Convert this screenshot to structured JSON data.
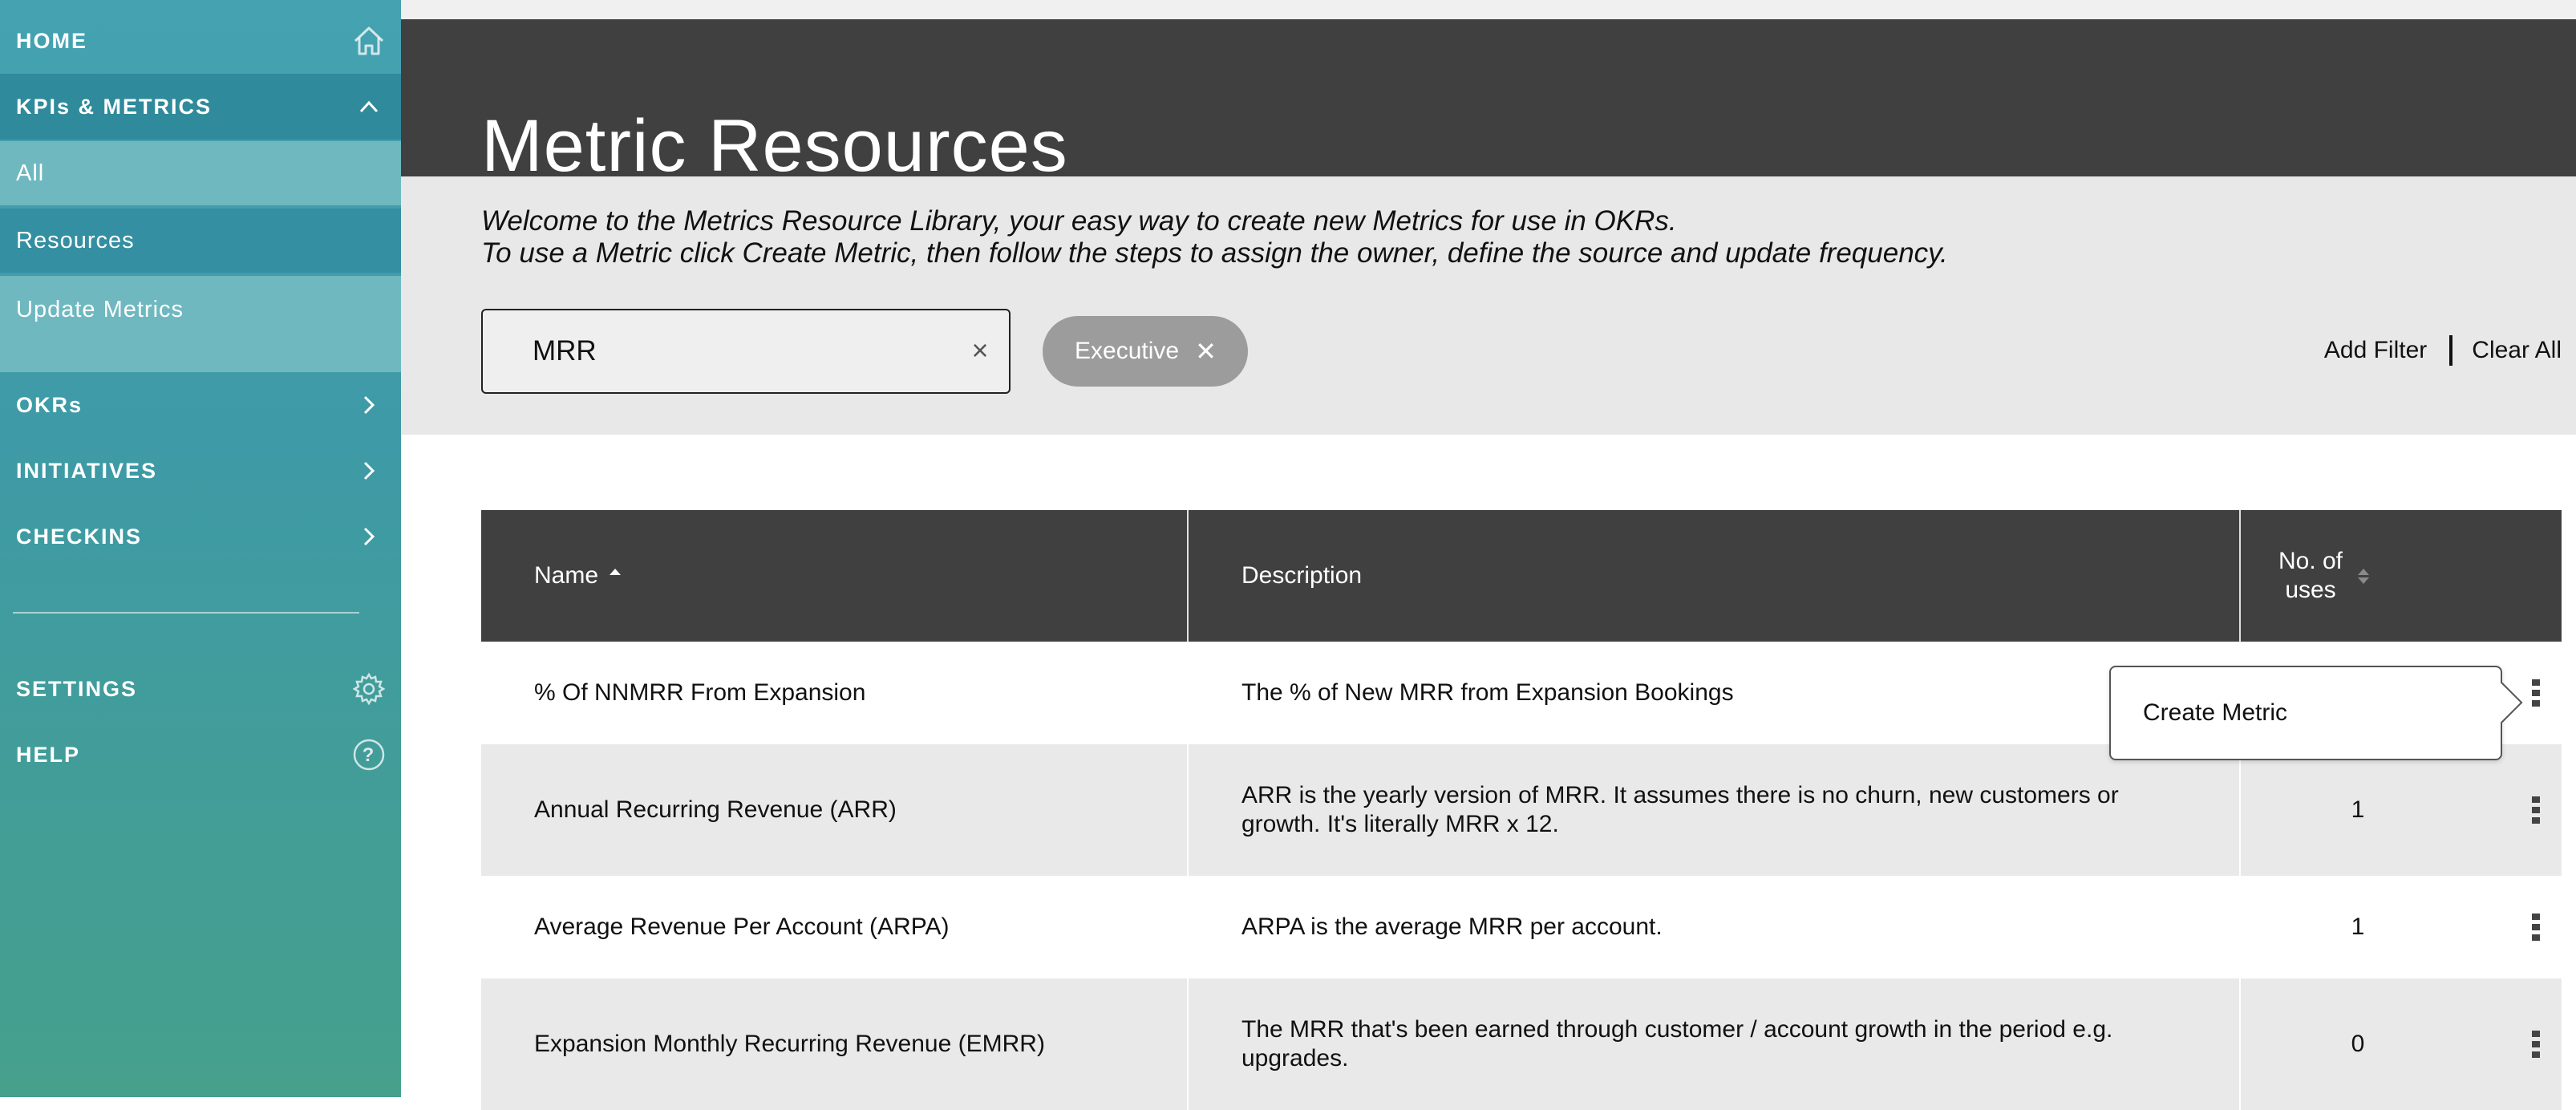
{
  "sidebar": {
    "home": {
      "label": "HOME",
      "icon": "home-icon"
    },
    "kpis": {
      "label": "KPIs & METRICS",
      "icon": "chevron-up-icon"
    },
    "sub_items": [
      {
        "label": "All"
      },
      {
        "label": "Resources"
      },
      {
        "label": "Update Metrics"
      }
    ],
    "okrs": {
      "label": "OKRs",
      "icon": "chevron-right-icon"
    },
    "initiatives": {
      "label": "INITIATIVES",
      "icon": "chevron-right-icon"
    },
    "checkins": {
      "label": "CHECKINS",
      "icon": "chevron-right-icon"
    },
    "settings": {
      "label": "SETTINGS",
      "icon": "gear-icon"
    },
    "help": {
      "label": "HELP",
      "icon": "question-icon"
    }
  },
  "header": {
    "title": "Metric Resources"
  },
  "intro": {
    "line1": "Welcome to the Metrics Resource Library, your easy way to create new Metrics for use in OKRs.",
    "line2": "To use a Metric click Create Metric, then follow the steps to assign the owner, define the source and update frequency."
  },
  "filters": {
    "search_value": "MRR",
    "clear_glyph": "×",
    "chip_label": "Executive",
    "chip_remove_glyph": "✕",
    "add_filter": "Add Filter",
    "clear_all": "Clear All"
  },
  "table": {
    "columns": {
      "name": "Name",
      "description": "Description",
      "uses": "No. of uses"
    },
    "rows": [
      {
        "name": "% Of NNMRR From Expansion",
        "description": "The % of New MRR from Expansion Bookings",
        "uses": ""
      },
      {
        "name": "Annual Recurring Revenue (ARR)",
        "description": "ARR is the yearly version of MRR. It assumes there is no churn, new customers or growth. It's literally MRR x 12.",
        "uses": "1"
      },
      {
        "name": "Average Revenue Per Account (ARPA)",
        "description": "ARPA is the average MRR per account.",
        "uses": "1"
      },
      {
        "name": "Expansion Monthly Recurring Revenue (EMRR)",
        "description": "The MRR that's been earned through customer / account growth in the period e.g. upgrades.",
        "uses": "0"
      }
    ]
  },
  "popover": {
    "label": "Create Metric"
  },
  "colors": {
    "header_bg": "#404040",
    "sidebar_top": "#45a2b1",
    "sidebar_bottom": "#46a08c",
    "active_item": "#338fa1",
    "chip_bg": "#9c9c9c",
    "row_grey": "#e9e9e9"
  }
}
